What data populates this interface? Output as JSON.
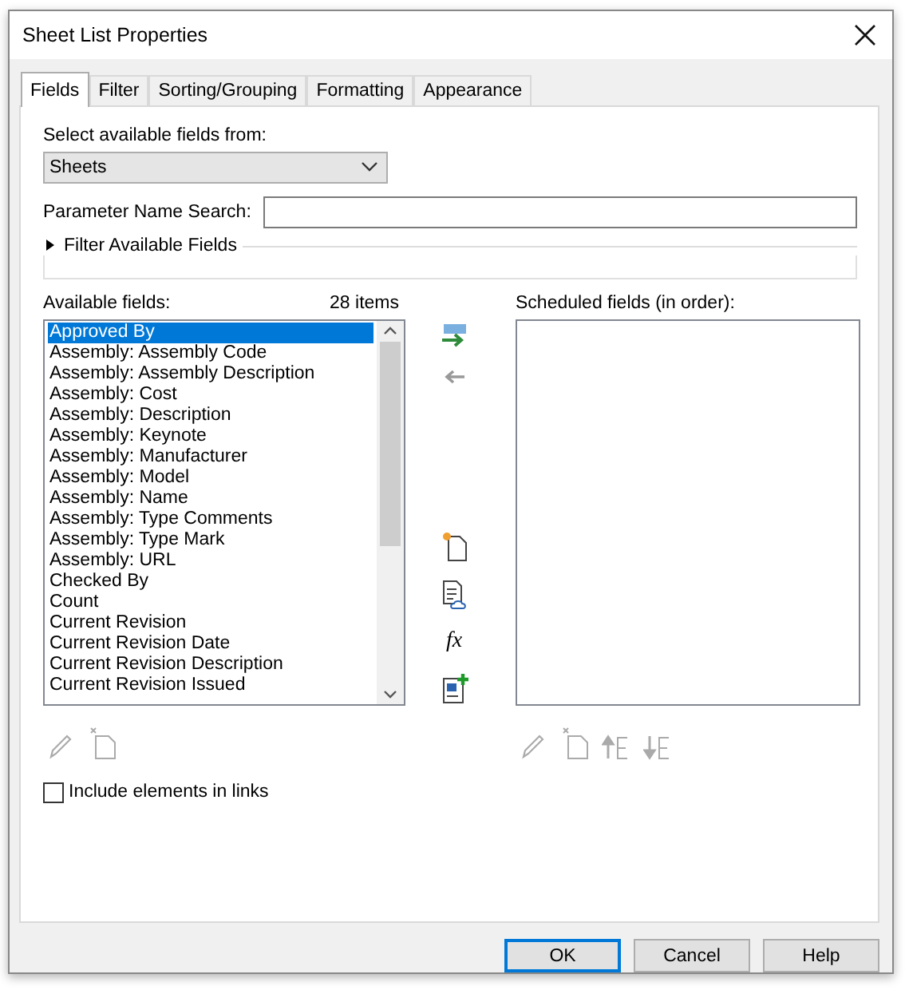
{
  "window": {
    "title": "Sheet List Properties"
  },
  "tabs": [
    {
      "label": "Fields",
      "selected": true
    },
    {
      "label": "Filter",
      "selected": false
    },
    {
      "label": "Sorting/Grouping",
      "selected": false
    },
    {
      "label": "Formatting",
      "selected": false
    },
    {
      "label": "Appearance",
      "selected": false
    }
  ],
  "source": {
    "label": "Select available fields from:",
    "value": "Sheets"
  },
  "search": {
    "label": "Parameter Name Search:"
  },
  "filter_expander": {
    "label": "Filter Available Fields",
    "expanded": false
  },
  "available": {
    "label": "Available fields:",
    "count": "28 items",
    "items": [
      {
        "label": "Approved By",
        "selected": true
      },
      {
        "label": "Assembly: Assembly Code",
        "selected": false
      },
      {
        "label": "Assembly: Assembly Description",
        "selected": false
      },
      {
        "label": "Assembly: Cost",
        "selected": false
      },
      {
        "label": "Assembly: Description",
        "selected": false
      },
      {
        "label": "Assembly: Keynote",
        "selected": false
      },
      {
        "label": "Assembly: Manufacturer",
        "selected": false
      },
      {
        "label": "Assembly: Model",
        "selected": false
      },
      {
        "label": "Assembly: Name",
        "selected": false
      },
      {
        "label": "Assembly: Type Comments",
        "selected": false
      },
      {
        "label": "Assembly: Type Mark",
        "selected": false
      },
      {
        "label": "Assembly: URL",
        "selected": false
      },
      {
        "label": "Checked By",
        "selected": false
      },
      {
        "label": "Count",
        "selected": false
      },
      {
        "label": "Current Revision",
        "selected": false
      },
      {
        "label": "Current Revision Date",
        "selected": false
      },
      {
        "label": "Current Revision Description",
        "selected": false
      },
      {
        "label": "Current Revision Issued",
        "selected": false
      }
    ]
  },
  "formula_glyph": "fx",
  "scheduled": {
    "label": "Scheduled fields (in order):"
  },
  "include_links": {
    "label": "Include elements in links",
    "checked": false
  },
  "buttons": [
    {
      "label": "OK",
      "default": true
    },
    {
      "label": "Cancel",
      "default": false
    },
    {
      "label": "Help",
      "default": false
    }
  ]
}
